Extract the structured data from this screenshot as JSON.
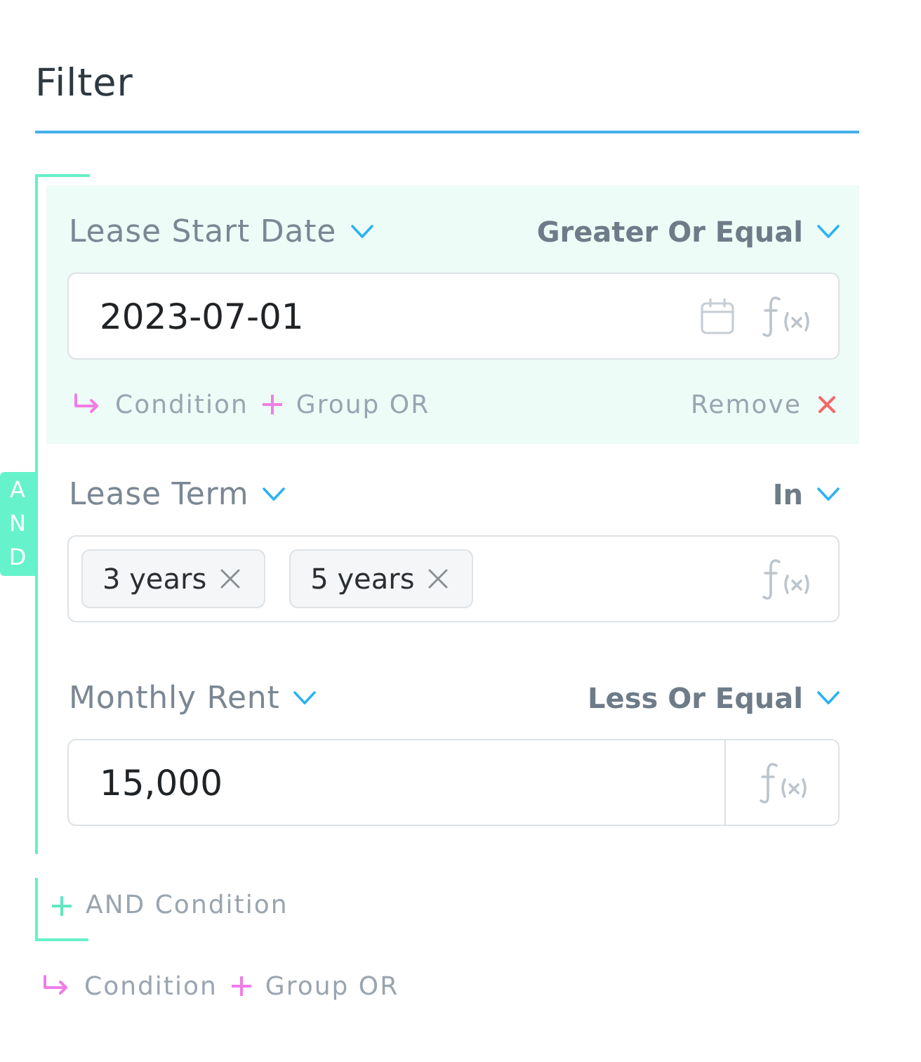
{
  "title": "Filter",
  "group": {
    "badge": "AND",
    "conditions": [
      {
        "field": "Lease Start Date",
        "operator": "Greater Or Equal",
        "kind": "date",
        "value": "2023-07-01",
        "active": true,
        "actions": {
          "condition": "Condition",
          "group": "Group OR",
          "remove": "Remove"
        }
      },
      {
        "field": "Lease Term",
        "operator": "In",
        "kind": "tags",
        "tags": [
          "3 years",
          "5 years"
        ],
        "active": false
      },
      {
        "field": "Monthly Rent",
        "operator": "Less Or Equal",
        "kind": "number",
        "value": "15,000",
        "active": false
      }
    ],
    "add_condition": "AND Condition"
  },
  "footer_actions": {
    "condition": "Condition",
    "group": "Group OR"
  }
}
